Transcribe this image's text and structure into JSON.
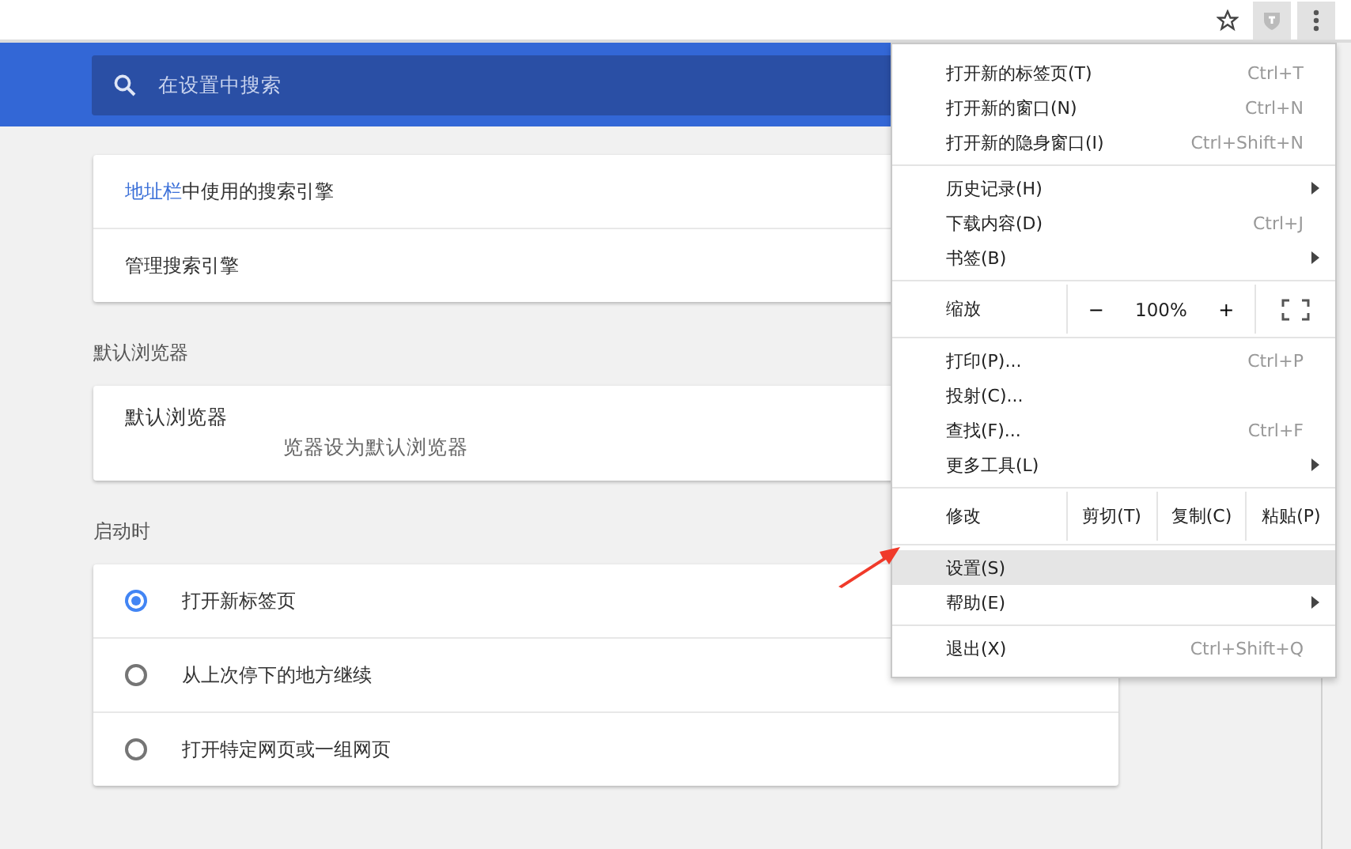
{
  "search": {
    "placeholder": "在设置中搜索"
  },
  "search_engine_card": [
    {
      "link": "地址栏",
      "text": "中使用的搜索引擎"
    },
    {
      "text": "管理搜索引擎"
    }
  ],
  "default_browser": {
    "heading": "默认浏览器",
    "title": "默认浏览器",
    "subtitle": "览器设为默认浏览器"
  },
  "startup": {
    "heading": "启动时",
    "options": [
      {
        "label": "打开新标签页",
        "selected": true
      },
      {
        "label": "从上次停下的地方继续",
        "selected": false
      },
      {
        "label": "打开特定网页或一组网页",
        "selected": false
      }
    ]
  },
  "menu": {
    "sections": [
      {
        "kind": "items",
        "items": [
          {
            "label": "打开新的标签页(T)",
            "shortcut": "Ctrl+T",
            "submenu": false,
            "selected": false
          },
          {
            "label": "打开新的窗口(N)",
            "shortcut": "Ctrl+N",
            "submenu": false,
            "selected": false
          },
          {
            "label": "打开新的隐身窗口(I)",
            "shortcut": "Ctrl+Shift+N",
            "submenu": false,
            "selected": false
          }
        ]
      },
      {
        "kind": "items",
        "items": [
          {
            "label": "历史记录(H)",
            "submenu": true,
            "selected": false
          },
          {
            "label": "下载内容(D)",
            "shortcut": "Ctrl+J",
            "submenu": false,
            "selected": false
          },
          {
            "label": "书签(B)",
            "submenu": true,
            "selected": false
          }
        ]
      },
      {
        "kind": "zoom",
        "label": "缩放",
        "minus": "−",
        "value": "100%",
        "plus": "+"
      },
      {
        "kind": "items",
        "items": [
          {
            "label": "打印(P)...",
            "shortcut": "Ctrl+P",
            "submenu": false,
            "selected": false
          },
          {
            "label": "投射(C)...",
            "submenu": false,
            "selected": false
          },
          {
            "label": "查找(F)...",
            "shortcut": "Ctrl+F",
            "submenu": false,
            "selected": false
          },
          {
            "label": "更多工具(L)",
            "submenu": true,
            "selected": false
          }
        ]
      },
      {
        "kind": "edit",
        "label": "修改",
        "buttons": [
          "剪切(T)",
          "复制(C)",
          "粘贴(P)"
        ]
      },
      {
        "kind": "items",
        "items": [
          {
            "label": "设置(S)",
            "submenu": false,
            "selected": true
          },
          {
            "label": "帮助(E)",
            "submenu": true,
            "selected": false
          }
        ]
      },
      {
        "kind": "items",
        "items": [
          {
            "label": "退出(X)",
            "shortcut": "Ctrl+Shift+Q",
            "submenu": false,
            "selected": false
          }
        ]
      }
    ]
  }
}
